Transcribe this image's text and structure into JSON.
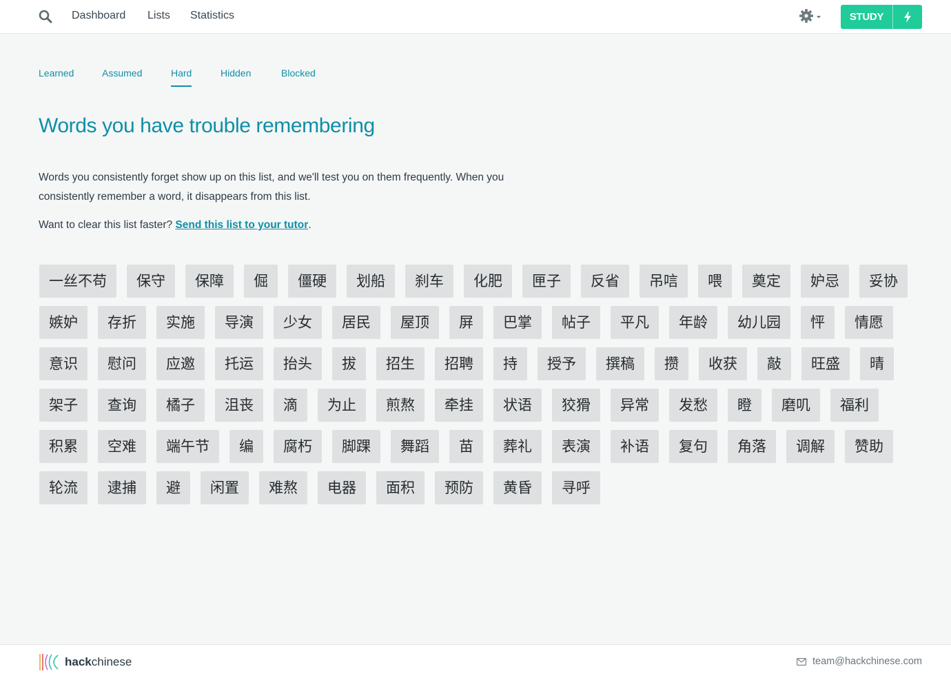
{
  "nav": {
    "links": [
      "Dashboard",
      "Lists",
      "Statistics"
    ],
    "study_label": "STUDY"
  },
  "tabs": {
    "items": [
      "Learned",
      "Assumed",
      "Hard",
      "Hidden",
      "Blocked"
    ],
    "active": "Hard"
  },
  "page": {
    "title": "Words you have trouble remembering",
    "description": "Words you consistently forget show up on this list, and we'll test you on them frequently. When you consistently remember a word, it disappears from this list.",
    "cta_prefix": "Want to clear this list faster? ",
    "cta_link": "Send this list to your tutor",
    "cta_suffix": "."
  },
  "words": [
    "一丝不苟",
    "保守",
    "保障",
    "倔",
    "僵硬",
    "划船",
    "刹车",
    "化肥",
    "匣子",
    "反省",
    "吊唁",
    "喂",
    "奠定",
    "妒忌",
    "妥协",
    "嫉妒",
    "存折",
    "实施",
    "导演",
    "少女",
    "居民",
    "屋顶",
    "屏",
    "巴掌",
    "帖子",
    "平凡",
    "年龄",
    "幼儿园",
    "怦",
    "情愿",
    "意识",
    "慰问",
    "应邀",
    "托运",
    "抬头",
    "拔",
    "招生",
    "招聘",
    "持",
    "授予",
    "撰稿",
    "攒",
    "收获",
    "敲",
    "旺盛",
    "晴",
    "架子",
    "查询",
    "橘子",
    "沮丧",
    "滴",
    "为止",
    "煎熬",
    "牵挂",
    "状语",
    "狡猾",
    "异常",
    "发愁",
    "瞪",
    "磨叽",
    "福利",
    "积累",
    "空难",
    "端午节",
    "编",
    "腐朽",
    "脚踝",
    "舞蹈",
    "苗",
    "葬礼",
    "表演",
    "补语",
    "复句",
    "角落",
    "调解",
    "赞助",
    "轮流",
    "逮捕",
    "避",
    "闲置",
    "难熬",
    "电器",
    "面积",
    "预防",
    "黄昏",
    "寻呼"
  ],
  "footer": {
    "logo_hack": "hack",
    "logo_chinese": "chinese",
    "email": "team@hackchinese.com"
  },
  "colors": {
    "accent": "#0f8fa6",
    "study_button": "#1fcc9a",
    "chip_bg": "#dfe0e1",
    "page_bg": "#f5f7f7"
  },
  "icons": {
    "search": "search-icon",
    "settings": "gear-icon",
    "study_fast": "lightning-bolt-icon",
    "email": "envelope-icon"
  }
}
